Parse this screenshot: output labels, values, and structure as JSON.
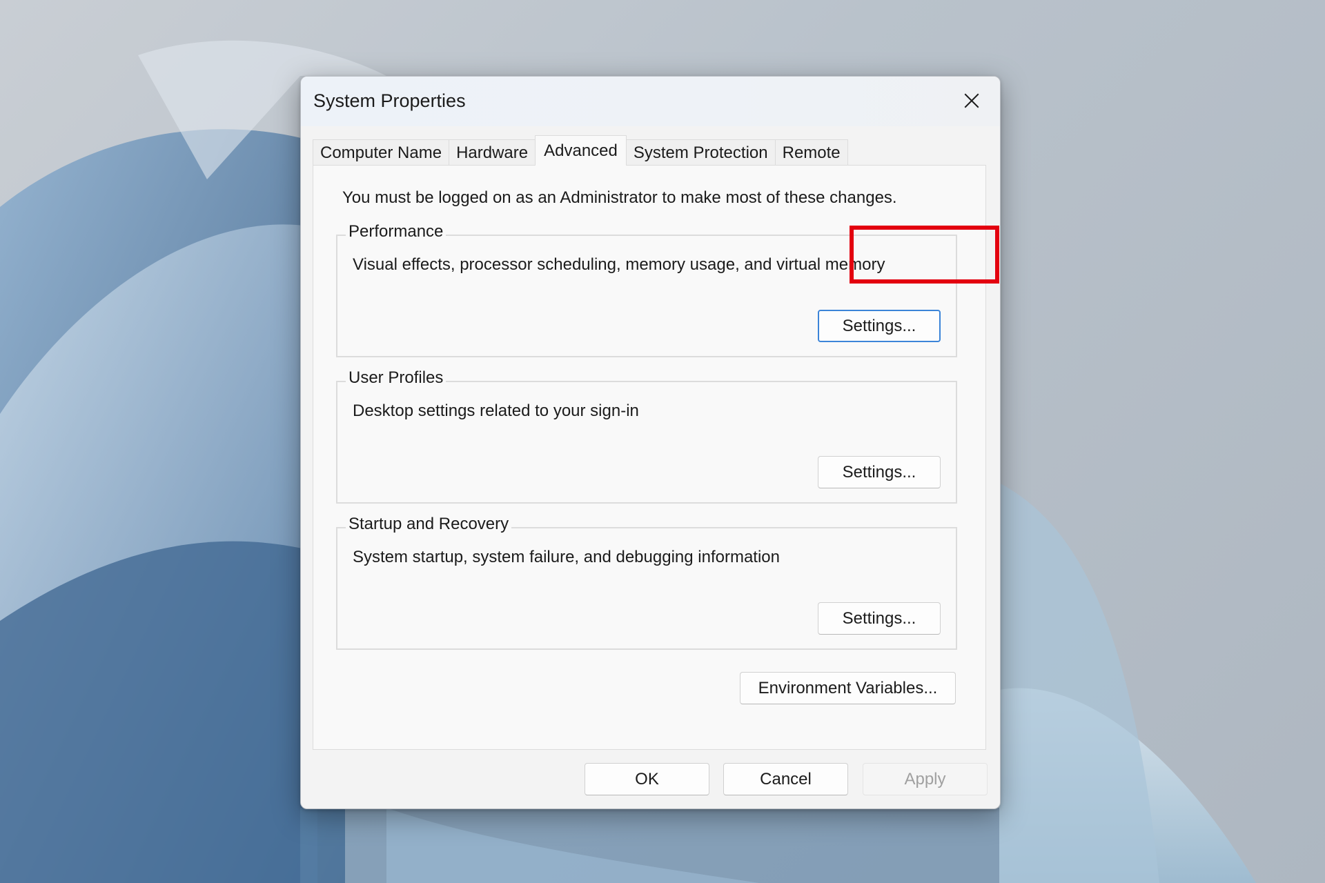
{
  "window": {
    "title": "System Properties",
    "close_icon": "close-icon"
  },
  "tabs": [
    {
      "label": "Computer Name",
      "active": false
    },
    {
      "label": "Hardware",
      "active": false
    },
    {
      "label": "Advanced",
      "active": true
    },
    {
      "label": "System Protection",
      "active": false
    },
    {
      "label": "Remote",
      "active": false
    }
  ],
  "advanced": {
    "admin_note": "You must be logged on as an Administrator to make most of these changes.",
    "performance": {
      "legend": "Performance",
      "description": "Visual effects, processor scheduling, memory usage, and virtual memory",
      "button": "Settings...",
      "highlighted": true,
      "highlight_color": "#e3000f"
    },
    "user_profiles": {
      "legend": "User Profiles",
      "description": "Desktop settings related to your sign-in",
      "button": "Settings..."
    },
    "startup_recovery": {
      "legend": "Startup and Recovery",
      "description": "System startup, system failure, and debugging information",
      "button": "Settings..."
    },
    "env_button": "Environment Variables..."
  },
  "footer": {
    "ok": "OK",
    "cancel": "Cancel",
    "apply": "Apply",
    "apply_disabled": true
  }
}
